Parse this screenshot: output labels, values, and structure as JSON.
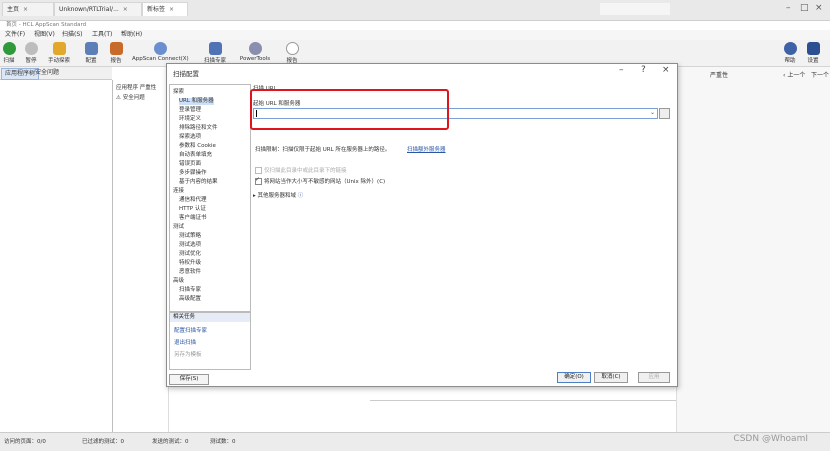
{
  "browser_tabs": [
    {
      "label": "主页"
    },
    {
      "label": "Unknown/RTLTrial/..."
    },
    {
      "label": "新标签"
    }
  ],
  "app_title": "首页 - HCL AppScan Standard",
  "menubar": [
    "文件(F)",
    "视图(V)",
    "扫描(S)",
    "工具(T)",
    "帮助(H)"
  ],
  "toolbar": {
    "left": [
      "扫描",
      "暂停",
      "手动探索",
      "配置",
      "报告",
      "AppScan Connect(X)",
      "扫描专家",
      "PowerTools",
      "报告"
    ],
    "right": [
      "帮助",
      "设置"
    ]
  },
  "left_tabs": [
    "应用程序树",
    "安全问题"
  ],
  "mid_pane": {
    "header": "应用程序 严重性",
    "item": "安全问题"
  },
  "right_area": {
    "filter": "严重性",
    "prev": "上一个",
    "next": "下一个"
  },
  "dialog": {
    "title": "扫描配置",
    "tree_items": [
      {
        "label": "探索",
        "indent": 0,
        "selected": false
      },
      {
        "label": "URL 和服务器",
        "indent": 1,
        "selected": true
      },
      {
        "label": "登录管理",
        "indent": 1,
        "selected": false
      },
      {
        "label": "环境定义",
        "indent": 1,
        "selected": false
      },
      {
        "label": "排除路径和文件",
        "indent": 1,
        "selected": false
      },
      {
        "label": "探索选项",
        "indent": 1,
        "selected": false
      },
      {
        "label": "参数和 Cookie",
        "indent": 1,
        "selected": false
      },
      {
        "label": "自动表单填充",
        "indent": 1,
        "selected": false
      },
      {
        "label": "错误页面",
        "indent": 1,
        "selected": false
      },
      {
        "label": "多步骤操作",
        "indent": 1,
        "selected": false
      },
      {
        "label": "基于内容的结果",
        "indent": 1,
        "selected": false
      },
      {
        "label": "连接",
        "indent": 0,
        "selected": false
      },
      {
        "label": "通信和代理",
        "indent": 1,
        "selected": false
      },
      {
        "label": "HTTP 认证",
        "indent": 1,
        "selected": false
      },
      {
        "label": "客户端证书",
        "indent": 1,
        "selected": false
      },
      {
        "label": "测试",
        "indent": 0,
        "selected": false
      },
      {
        "label": "测试策略",
        "indent": 1,
        "selected": false
      },
      {
        "label": "测试选项",
        "indent": 1,
        "selected": false
      },
      {
        "label": "测试优化",
        "indent": 1,
        "selected": false
      },
      {
        "label": "特权升级",
        "indent": 1,
        "selected": false
      },
      {
        "label": "恶意软件",
        "indent": 1,
        "selected": false
      },
      {
        "label": "高级",
        "indent": 0,
        "selected": false
      },
      {
        "label": "扫描专家",
        "indent": 1,
        "selected": false
      },
      {
        "label": "高级配置",
        "indent": 1,
        "selected": false
      }
    ],
    "related": {
      "header": "相关任务",
      "items": [
        {
          "label": "配置扫描专家",
          "disabled": false
        },
        {
          "label": "退出扫描",
          "disabled": false
        },
        {
          "label": "另存为模板",
          "disabled": true
        }
      ]
    },
    "manage_button": "保存(S)",
    "section_title": "扫描 URL",
    "url_label": "起始 URL 和服务器",
    "url_value": "",
    "info_text": "扫描限制：扫描仅限于起始 URL 所在服务器上的路径。",
    "info_link": "扫描额外服务器",
    "checkboxes": [
      {
        "label": "仅扫描此目录中或此目录下的链接",
        "checked": false,
        "disabled": true
      },
      {
        "label": "将网站当作大小写不敏感的网站（Unix 除外）(C)",
        "checked": true,
        "disabled": false
      }
    ],
    "more_label": "其他服务器和域",
    "footer_buttons": [
      {
        "label": "确定(O)",
        "primary": true,
        "disabled": false
      },
      {
        "label": "取消(C)",
        "primary": false,
        "disabled": false
      },
      {
        "label": "应用",
        "primary": false,
        "disabled": true
      }
    ]
  },
  "statusbar": [
    "访问的页面：0/0",
    "已过滤的测试：0",
    "发送的测试：0",
    "测试数：0"
  ],
  "watermark": "CSDN @WhoamI"
}
